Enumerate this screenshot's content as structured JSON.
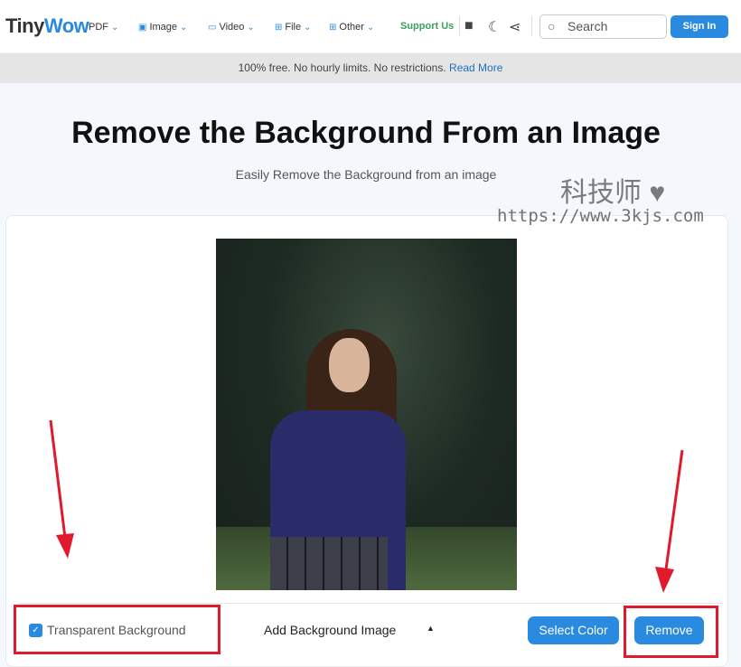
{
  "nav": {
    "logo_a": "Tiny",
    "logo_b": "Wow",
    "items": [
      {
        "label": "PDF",
        "icon": "pdf-icon"
      },
      {
        "label": "Image",
        "icon": "image-icon"
      },
      {
        "label": "Video",
        "icon": "video-icon"
      },
      {
        "label": "File",
        "icon": "grid-icon"
      },
      {
        "label": "Other",
        "icon": "grid-icon"
      }
    ],
    "support": "Support Us",
    "search_placeholder": "Search",
    "signin": "Sign In"
  },
  "banner": {
    "text": "100% free. No hourly limits. No restrictions.",
    "link": "Read More"
  },
  "title": "Remove the Background From an Image",
  "subtitle": "Easily Remove the Background from an image",
  "watermark": {
    "text": "科技师",
    "url": "https://www.3kjs.com"
  },
  "controls": {
    "transparent_label": "Transparent Background",
    "transparent_checked": true,
    "add_bg": "Add Background Image",
    "select_color": "Select Color",
    "remove": "Remove"
  },
  "colors": {
    "accent": "#2a8ae0",
    "annotation": "#e0192b"
  }
}
